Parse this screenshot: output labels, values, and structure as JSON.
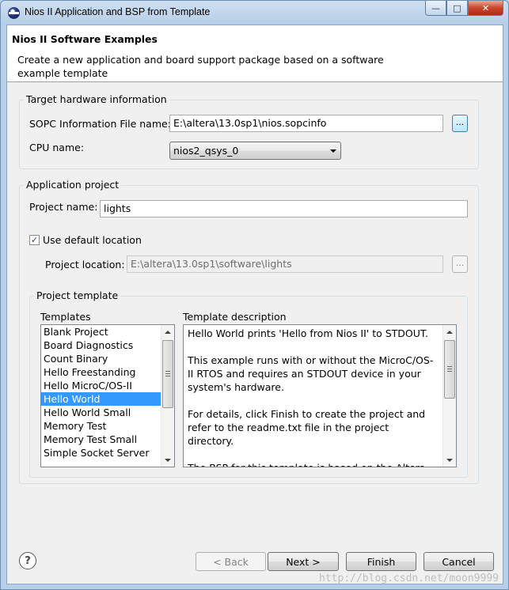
{
  "window": {
    "title": "Nios II Application and BSP from Template",
    "minimize": "—",
    "maximize": "□",
    "close": "✕"
  },
  "banner": {
    "title": "Nios II Software Examples",
    "description": "Create a new application and board support package based on a software example template"
  },
  "target_hw": {
    "group_label": "Target hardware information",
    "sopc_label": "SOPC Information File name:",
    "sopc_value": "E:\\altera\\13.0sp1\\nios.sopcinfo",
    "browse_label": "...",
    "cpu_label": "CPU name:",
    "cpu_value": "nios2_qsys_0"
  },
  "app_project": {
    "group_label": "Application project",
    "name_label": "Project name:",
    "name_value": "lights",
    "use_default_label": "Use default location",
    "use_default_checked": true,
    "location_label": "Project location:",
    "location_value": "E:\\altera\\13.0sp1\\software\\lights",
    "browse_label": "..."
  },
  "project_template": {
    "group_label": "Project template",
    "templates_label": "Templates",
    "description_label": "Template description",
    "templates": [
      "Blank Project",
      "Board Diagnostics",
      "Count Binary",
      "Hello Freestanding",
      "Hello MicroC/OS-II",
      "Hello World",
      "Hello World Small",
      "Memory Test",
      "Memory Test Small",
      "Simple Socket Server"
    ],
    "selected_template": "Hello World",
    "description": "Hello World prints 'Hello from Nios II' to STDOUT.\n\nThis example runs with or without the MicroC/OS-II RTOS and requires an STDOUT device in your system's hardware.\n\nFor details, click Finish to create the project and refer to the readme.txt file in the project directory.\n\nThe BSP for this template is based on the Altera HAL"
  },
  "buttons": {
    "help": "?",
    "back": "< Back",
    "next": "Next >",
    "finish": "Finish",
    "cancel": "Cancel"
  },
  "watermark": "http://blog.csdn.net/moon9999"
}
